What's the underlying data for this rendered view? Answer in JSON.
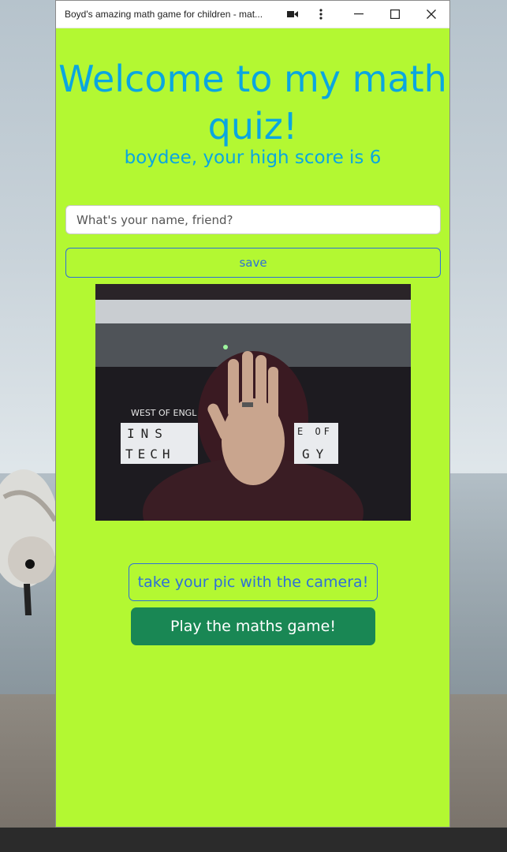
{
  "window": {
    "title": "Boyd's amazing math game for children - mat...",
    "controls": {
      "camera_icon": "camera-icon",
      "menu_icon": "vertical-dots-icon",
      "minimize_icon": "minimize-icon",
      "maximize_icon": "maximize-icon",
      "close_icon": "close-icon"
    }
  },
  "page": {
    "heading": "Welcome to my math quiz!",
    "high_score_text": "boydee, your high score is 6",
    "name_input": {
      "placeholder": "What's your name, friend?",
      "value": ""
    },
    "save_label": "save",
    "camera_sign": {
      "line1": "WEST OF ENGL",
      "line2_left": "INS",
      "line2_right": "E OF",
      "line3_left": "TECH",
      "line3_right": "GY"
    },
    "take_pic_label": "take your pic with the camera!",
    "play_label": "Play the maths game!"
  },
  "colors": {
    "app_background": "#b3f832",
    "heading_text": "#0aa6e0",
    "outline_button": "#2e6fd8",
    "play_button": "#198754"
  }
}
